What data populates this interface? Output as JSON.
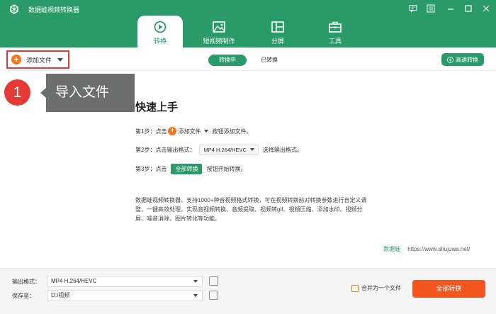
{
  "app": {
    "title": "数据蛙视频转换器"
  },
  "nav": {
    "tabs": [
      {
        "label": "转换",
        "icon": "convert-icon",
        "active": true
      },
      {
        "label": "短视频制作",
        "icon": "image-icon",
        "active": false
      },
      {
        "label": "分屏",
        "icon": "split-screen-icon",
        "active": false
      },
      {
        "label": "工具",
        "icon": "toolbox-icon",
        "active": false
      }
    ]
  },
  "toolbar": {
    "add_file": "添加文件",
    "converting": "转换中",
    "converted": "已转换",
    "fast_convert": "高速转换"
  },
  "callout": {
    "number": "1",
    "text": "导入文件"
  },
  "quickstart": {
    "title": "快速上手",
    "step1_prefix": "第1步：点击",
    "step1_button": "添加文件",
    "step1_suffix": "按钮添加文件。",
    "step2_prefix": "第2步：点击输出格式：",
    "step2_format": "MP4 H.264/HEVC",
    "step2_suffix": "选择输出格式。",
    "step3_prefix": "第3步：点击",
    "step3_button": "全部转换",
    "step3_suffix": "按钮开始转换。",
    "description": "数据蛙视频转换器，支持1000+种音视频格式转换，可在视频转换前对转换参数进行自定义调整，一键高效处理，实现音视频转换、音频提取、视频转gif、视频压缩、添加水印、视频分屏、噪音消除、图片转化等功能。",
    "brand": "数据蛙",
    "url": "https://www.shujuwa.net/"
  },
  "bottom": {
    "output_format_label": "输出格式：",
    "output_format_value": "MP4 H.264/HEVC",
    "save_to_label": "保存至：",
    "save_to_value": "D:\\视频",
    "merge_label": "合并为一个文件",
    "merge_checked": false,
    "convert_all": "全部转换"
  },
  "colors": {
    "primary": "#2a9a6b",
    "accent": "#f4561f",
    "highlight": "#e53935"
  }
}
